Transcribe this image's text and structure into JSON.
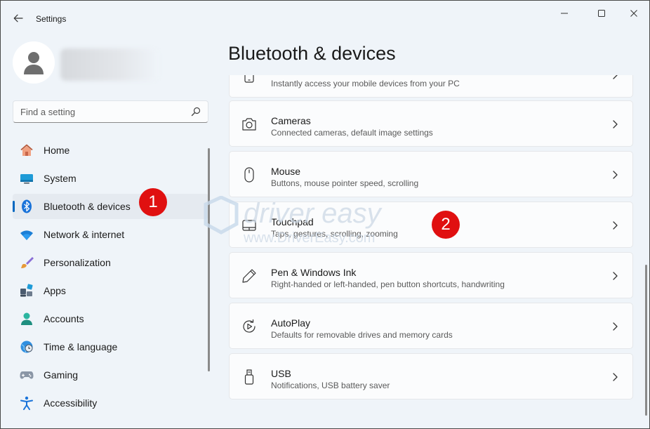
{
  "window": {
    "title": "Settings"
  },
  "search": {
    "placeholder": "Find a setting"
  },
  "nav": {
    "items": [
      {
        "label": "Home",
        "icon": "home-icon"
      },
      {
        "label": "System",
        "icon": "system-icon"
      },
      {
        "label": "Bluetooth & devices",
        "icon": "bluetooth-icon",
        "selected": true
      },
      {
        "label": "Network & internet",
        "icon": "wifi-icon"
      },
      {
        "label": "Personalization",
        "icon": "brush-icon"
      },
      {
        "label": "Apps",
        "icon": "apps-icon"
      },
      {
        "label": "Accounts",
        "icon": "person-icon"
      },
      {
        "label": "Time & language",
        "icon": "clock-globe-icon"
      },
      {
        "label": "Gaming",
        "icon": "gamepad-icon"
      },
      {
        "label": "Accessibility",
        "icon": "accessibility-icon"
      }
    ]
  },
  "main": {
    "title": "Bluetooth & devices",
    "cards": [
      {
        "title": "",
        "subtitle": "Instantly access your mobile devices from your PC",
        "icon": "phone-icon"
      },
      {
        "title": "Cameras",
        "subtitle": "Connected cameras, default image settings",
        "icon": "camera-icon"
      },
      {
        "title": "Mouse",
        "subtitle": "Buttons, mouse pointer speed, scrolling",
        "icon": "mouse-icon"
      },
      {
        "title": "Touchpad",
        "subtitle": "Taps, gestures, scrolling, zooming",
        "icon": "touchpad-icon"
      },
      {
        "title": "Pen & Windows Ink",
        "subtitle": "Right-handed or left-handed, pen button shortcuts, handwriting",
        "icon": "pen-icon"
      },
      {
        "title": "AutoPlay",
        "subtitle": "Defaults for removable drives and memory cards",
        "icon": "autoplay-icon"
      },
      {
        "title": "USB",
        "subtitle": "Notifications, USB battery saver",
        "icon": "usb-icon"
      }
    ]
  },
  "annotations": {
    "step1": "1",
    "step2": "2"
  },
  "watermark": {
    "brand": "driver easy",
    "url": "www.DriverEasy.com"
  },
  "colors": {
    "accent": "#0067c0",
    "badge": "#e01010",
    "background": "#eff4f9",
    "card": "#fbfcfd"
  }
}
